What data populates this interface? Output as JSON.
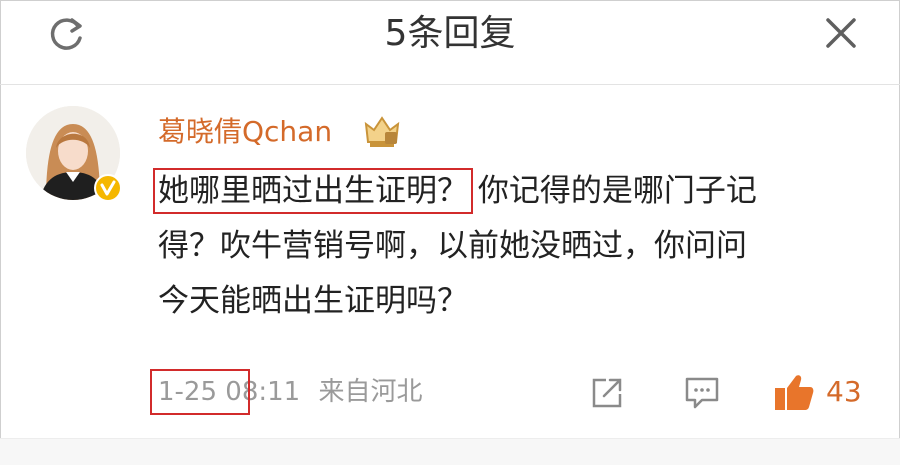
{
  "header": {
    "title": "5条回复",
    "left_icon": "refresh-icon",
    "right_icon": "close-icon"
  },
  "comment": {
    "username": "葛晓倩Qchan",
    "badge_icon": "crown-level-icon",
    "verified_icon": "verified-badge-icon",
    "text_highlight": "她哪里晒过出生证明？",
    "text_rest_line1": "你记得的是哪门子记",
    "text_rest_line2": "得？吹牛营销号啊，以前她没晒过，你问问",
    "text_rest_line3": "今天能晒出生证明吗？",
    "date_highlight": "1-25 0",
    "time_rest": "8:11",
    "source": "来自河北",
    "like_count": "43"
  },
  "colors": {
    "accent": "#d46a2a",
    "highlight_box": "#d22b2b",
    "meta_text": "#9a9a9a",
    "verified": "#f5b700"
  }
}
